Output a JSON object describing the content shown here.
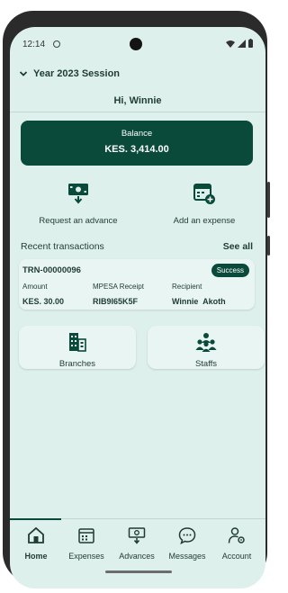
{
  "status_bar": {
    "time": "12:14"
  },
  "header": {
    "session_label": "Year 2023 Session"
  },
  "greeting": "Hi, Winnie",
  "balance": {
    "label": "Balance",
    "value": "KES. 3,414.00"
  },
  "actions": [
    {
      "label": "Request an advance",
      "icon": "cash-download-icon"
    },
    {
      "label": "Add an expense",
      "icon": "calendar-add-icon"
    }
  ],
  "recent": {
    "title": "Recent transactions",
    "see_all": "See all",
    "transaction": {
      "id": "TRN-00000096",
      "status": "Success",
      "amount_label": "Amount",
      "amount": "KES. 30.00",
      "receipt_label": "MPESA Receipt",
      "receipt": "RIB9I65K5F",
      "recipient_label": "Recipient",
      "recipient": "Winnie  Akoth"
    }
  },
  "tiles": [
    {
      "label": "Branches",
      "icon": "buildings-icon"
    },
    {
      "label": "Staffs",
      "icon": "people-icon"
    }
  ],
  "nav": {
    "items": [
      {
        "label": "Home",
        "icon": "home-icon",
        "active": true
      },
      {
        "label": "Expenses",
        "icon": "receipt-icon"
      },
      {
        "label": "Advances",
        "icon": "cash-icon"
      },
      {
        "label": "Messages",
        "icon": "chat-icon"
      },
      {
        "label": "Account",
        "icon": "user-gear-icon"
      }
    ]
  },
  "colors": {
    "primary": "#0a4a3a",
    "background": "#def0ec",
    "card": "#e8f5f2"
  }
}
